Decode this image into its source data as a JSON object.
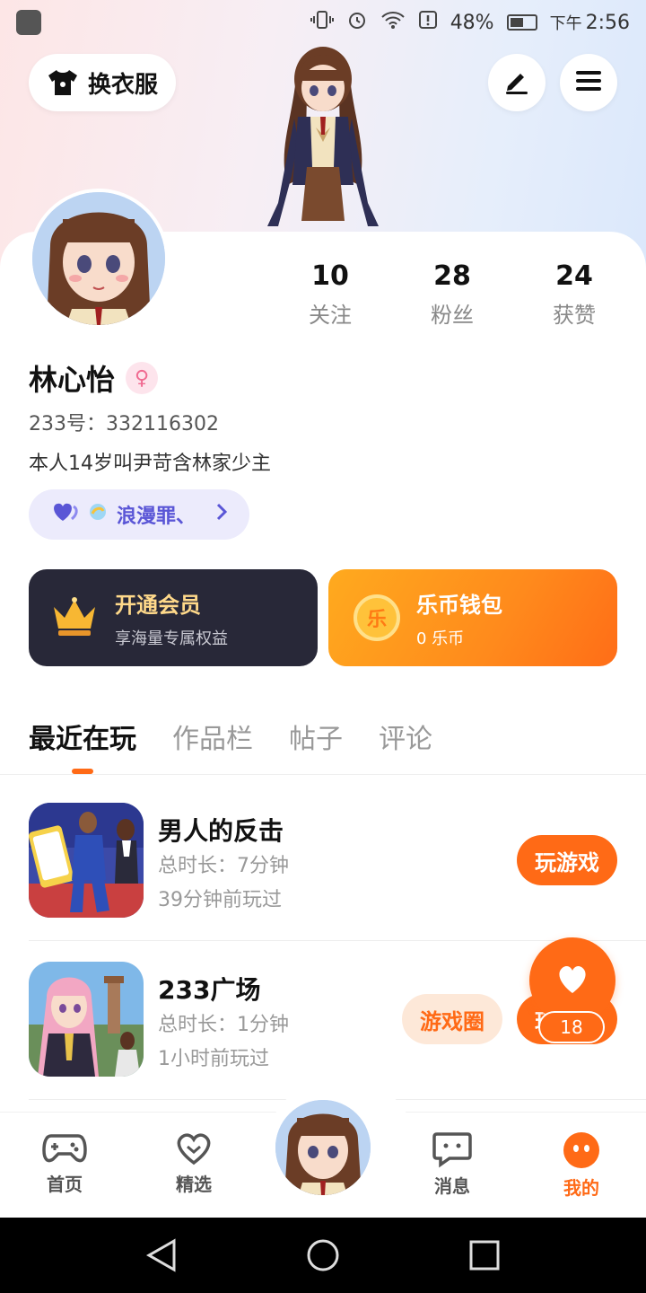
{
  "status_bar": {
    "battery": "48%",
    "ampm": "下午",
    "time": "2:56"
  },
  "header": {
    "outfit_label": "换衣服"
  },
  "stats": [
    {
      "value": "10",
      "label": "关注"
    },
    {
      "value": "28",
      "label": "粉丝"
    },
    {
      "value": "24",
      "label": "获赞"
    }
  ],
  "profile": {
    "name": "林心怡",
    "user_id": "233号：332116302",
    "bio": "本人14岁叫尹苛含林家少主",
    "tag": "浪漫罪、"
  },
  "vip": {
    "title": "开通会员",
    "subtitle": "享海量专属权益"
  },
  "wallet": {
    "title": "乐币钱包",
    "subtitle": "0 乐币",
    "coin_glyph": "乐"
  },
  "tabs": [
    "最近在玩",
    "作品栏",
    "帖子",
    "评论"
  ],
  "games": [
    {
      "name": "男人的反击",
      "time": "总时长：7分钟",
      "last_played": "39分钟前玩过",
      "play_label": "玩游戏"
    },
    {
      "name": "233广场",
      "time": "总时长：1分钟",
      "last_played": "1小时前玩过",
      "circle_label": "游戏圈",
      "play_label": "玩游戏"
    }
  ],
  "like_count": "18",
  "nav": {
    "home": "首页",
    "featured": "精选",
    "messages": "消息",
    "mine": "我的"
  },
  "colors": {
    "accent": "#ff6a16",
    "vip_bg": "#282838",
    "tag_text": "#5a56d6"
  }
}
